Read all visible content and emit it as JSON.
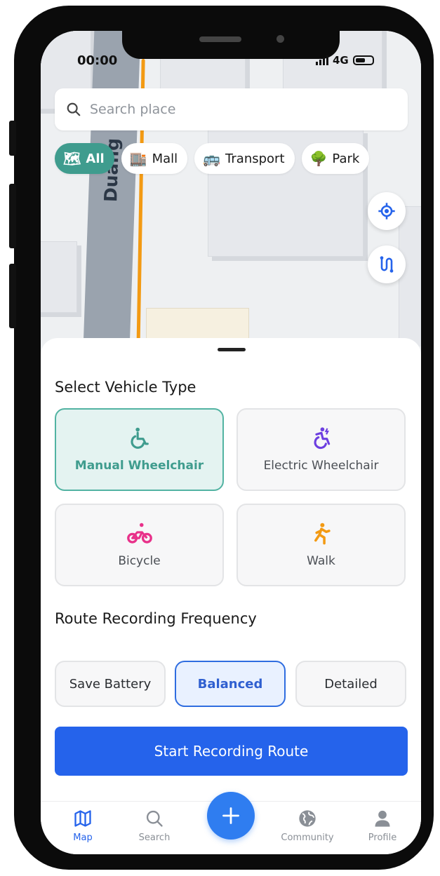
{
  "status_bar": {
    "time": "00:00",
    "network": "4G"
  },
  "search": {
    "placeholder": "Search place"
  },
  "map": {
    "street_label": "Duang Ud"
  },
  "categories": [
    {
      "label": "All",
      "icon": "map-emoji-icon",
      "active": true
    },
    {
      "label": "Mall",
      "icon": "building-emoji-icon",
      "active": false
    },
    {
      "label": "Transport",
      "icon": "bus-emoji-icon",
      "active": false
    },
    {
      "label": "Park",
      "icon": "tree-emoji-icon",
      "active": false
    }
  ],
  "sheet": {
    "vehicle_title": "Select Vehicle Type",
    "vehicles": [
      {
        "label": "Manual Wheelchair",
        "icon": "manual-wheelchair-icon",
        "color": "#3f9c8e",
        "selected": true
      },
      {
        "label": "Electric Wheelchair",
        "icon": "electric-wheelchair-icon",
        "color": "#6d3fe0",
        "selected": false
      },
      {
        "label": "Bicycle",
        "icon": "bicycle-icon",
        "color": "#e8318a",
        "selected": false
      },
      {
        "label": "Walk",
        "icon": "walk-icon",
        "color": "#f39a13",
        "selected": false
      }
    ],
    "frequency_title": "Route Recording Frequency",
    "frequencies": [
      {
        "label": "Save Battery",
        "selected": false
      },
      {
        "label": "Balanced",
        "selected": true
      },
      {
        "label": "Detailed",
        "selected": false
      }
    ],
    "start_button": "Start Recording Route"
  },
  "tabbar": {
    "items": [
      {
        "label": "Map",
        "icon": "map-icon",
        "active": true
      },
      {
        "label": "Search",
        "icon": "search-icon",
        "active": false
      },
      {
        "label": "Community",
        "icon": "globe-icon",
        "active": false
      },
      {
        "label": "Profile",
        "icon": "profile-icon",
        "active": false
      }
    ],
    "center_icon": "plus-icon"
  },
  "colors": {
    "accent_teal": "#3f9c8e",
    "accent_blue": "#2563eb",
    "route_orange": "#f39a13"
  }
}
